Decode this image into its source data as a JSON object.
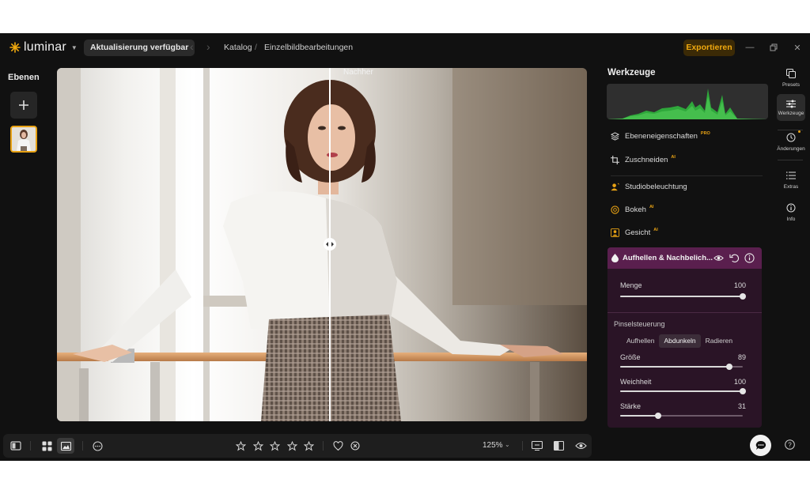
{
  "app": {
    "name": "luminar",
    "update_label": "Aktualisierung verfügbar",
    "export_label": "Exportieren"
  },
  "breadcrumb": {
    "catalog": "Katalog",
    "separator": "/",
    "current": "Einzelbildbearbeitungen"
  },
  "layers": {
    "title": "Ebenen"
  },
  "canvas": {
    "after_label": "Nachher"
  },
  "bottombar": {
    "zoom": "125%"
  },
  "tools": {
    "title": "Werkzeuge",
    "items": [
      {
        "label": "Ebeneneigenschaften",
        "badge": "PRO"
      },
      {
        "label": "Zuschneiden",
        "badge": "AI"
      },
      {
        "label": "Studiobeleuchtung",
        "badge": ""
      },
      {
        "label": "Bokeh",
        "badge": "AI"
      },
      {
        "label": "Gesicht",
        "badge": "AI"
      }
    ],
    "dodge_burn": {
      "title": "Aufhellen & Nachbelich...",
      "amount_label": "Menge",
      "amount_value": 100,
      "brush_label": "Pinselsteuerung",
      "modes": [
        "Aufhellen",
        "Abdunkeln",
        "Radieren"
      ],
      "active_mode": "Abdunkeln",
      "sliders": [
        {
          "label": "Größe",
          "value": 89
        },
        {
          "label": "Weichheit",
          "value": 100
        },
        {
          "label": "Stärke",
          "value": 31
        }
      ]
    }
  },
  "rail": {
    "items": [
      "Presets",
      "Werkzeuge",
      "Änderungen",
      "Extras",
      "Info"
    ],
    "active": "Werkzeuge"
  },
  "colors": {
    "accent": "#e8a214",
    "export_text": "#f0a90f",
    "panel_bg": "#111111",
    "dodge_header": "#5a1f4e"
  }
}
